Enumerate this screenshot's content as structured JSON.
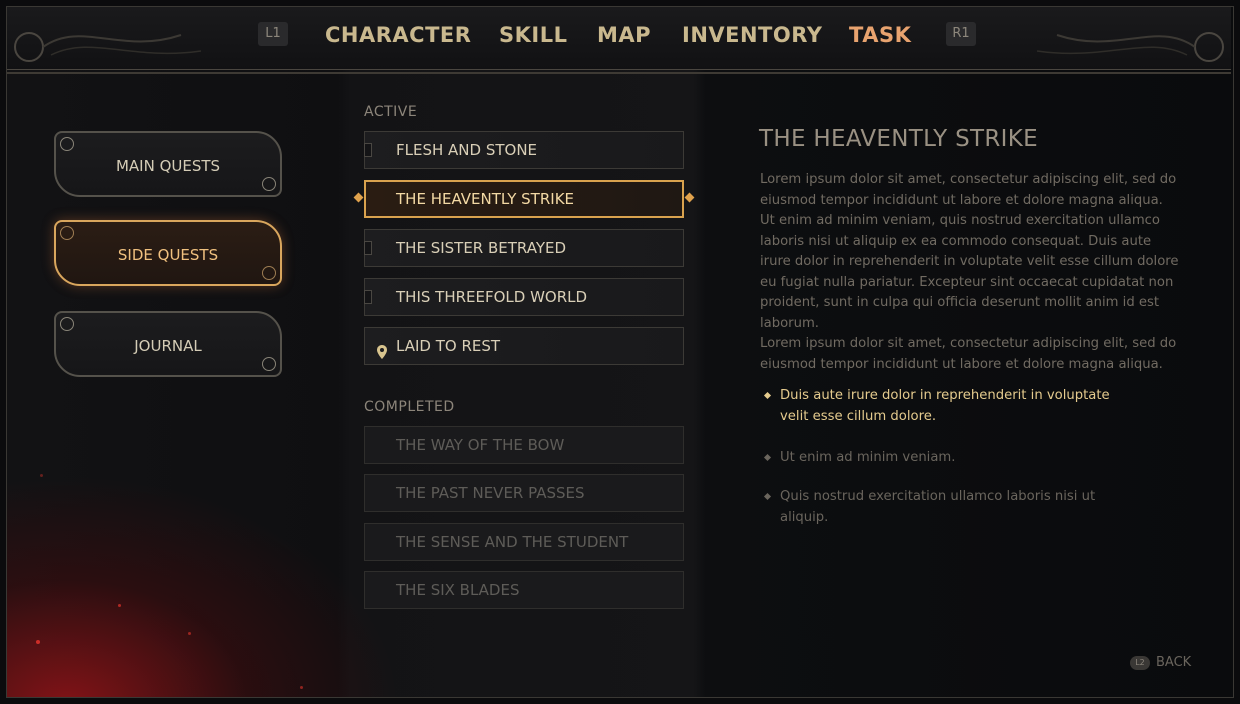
{
  "nav": {
    "left_key": "L1",
    "right_key": "R1",
    "tabs": [
      {
        "label": "CHARACTER"
      },
      {
        "label": "SKILL"
      },
      {
        "label": "MAP"
      },
      {
        "label": "INVENTORY"
      },
      {
        "label": "TASK",
        "active": true
      }
    ]
  },
  "categories": [
    {
      "label": "MAIN QUESTS",
      "active": false
    },
    {
      "label": "SIDE QUESTS",
      "active": true
    },
    {
      "label": "JOURNAL",
      "active": false
    }
  ],
  "quests": {
    "active_label": "ACTIVE",
    "active": [
      {
        "label": "FLESH AND STONE"
      },
      {
        "label": "THE HEAVENTLY STRIKE",
        "selected": true
      },
      {
        "label": "THE SISTER BETRAYED"
      },
      {
        "label": "THIS THREEFOLD WORLD"
      },
      {
        "label": "LAID TO REST",
        "icon": "map-pin-icon"
      }
    ],
    "completed_label": "COMPLETED",
    "completed": [
      {
        "label": "THE WAY OF THE BOW"
      },
      {
        "label": "THE PAST NEVER PASSES"
      },
      {
        "label": "THE SENSE AND THE STUDENT"
      },
      {
        "label": "THE SIX BLADES"
      }
    ]
  },
  "detail": {
    "title": "THE HEAVENTLY STRIKE",
    "body": "Lorem ipsum dolor sit amet, consectetur adipiscing elit, sed do eiusmod tempor incididunt ut labore et dolore magna aliqua. Ut enim ad minim veniam, quis nostrud exercitation ullamco laboris nisi ut aliquip ex ea commodo consequat. Duis aute irure dolor in reprehenderit in voluptate velit esse cillum dolore eu fugiat nulla pariatur. Excepteur sint occaecat cupidatat non proident, sunt in culpa qui officia deserunt mollit anim id est laborum.",
    "body2": "Lorem ipsum dolor sit amet, consectetur adipiscing elit, sed do eiusmod tempor incididunt ut labore et dolore magna aliqua.",
    "objectives": [
      {
        "text": "Duis aute irure dolor in reprehenderit in voluptate velit esse cillum dolore.",
        "current": true
      },
      {
        "text": "Ut enim ad minim veniam.",
        "current": false
      },
      {
        "text": "Quis nostrud exercitation ullamco laboris nisi ut aliquip.",
        "current": false
      }
    ]
  },
  "footer": {
    "back_key": "L2",
    "back_label": "BACK"
  },
  "colors": {
    "accent": "#e8a36f",
    "gold": "#d9a65d",
    "ember": "#b0141a"
  }
}
